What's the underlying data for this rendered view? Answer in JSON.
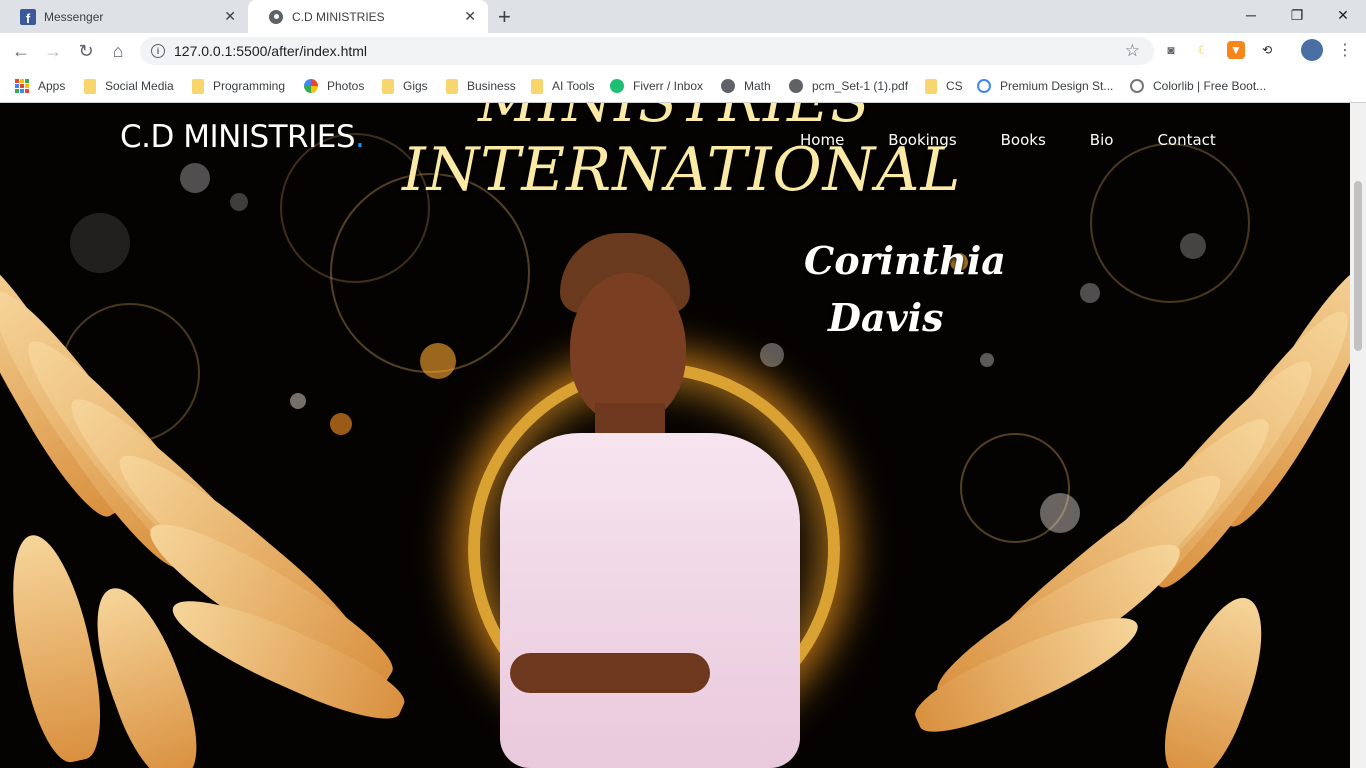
{
  "browser": {
    "tabs": [
      {
        "title": "Messenger",
        "icon": "facebook-icon",
        "active": false
      },
      {
        "title": "C.D MINISTRIES",
        "icon": "globe-icon",
        "active": true
      }
    ],
    "new_tab_symbol": "+",
    "url": "127.0.0.1:5500/after/index.html",
    "bookmarks": [
      {
        "label": "Apps",
        "icon": "apps-grid-icon"
      },
      {
        "label": "Social Media",
        "icon": "folder-icon"
      },
      {
        "label": "Programming",
        "icon": "folder-icon"
      },
      {
        "label": "Photos",
        "icon": "photos-pinwheel-icon"
      },
      {
        "label": "Gigs",
        "icon": "folder-icon"
      },
      {
        "label": "Business",
        "icon": "folder-icon"
      },
      {
        "label": "AI Tools",
        "icon": "folder-icon"
      },
      {
        "label": "Fiverr / Inbox",
        "icon": "fiverr-icon"
      },
      {
        "label": "Math",
        "icon": "globe-icon"
      },
      {
        "label": "pcm_Set-1 (1).pdf",
        "icon": "globe-icon"
      },
      {
        "label": "CS",
        "icon": "folder-icon"
      },
      {
        "label": "Premium Design St...",
        "icon": "link-icon"
      },
      {
        "label": "Colorlib | Free Boot...",
        "icon": "wordpress-icon"
      }
    ]
  },
  "site": {
    "logo": "C.D MINISTRIES",
    "logo_dot": ".",
    "banner_line1": "MINISTRIES",
    "banner_line2": "INTERNATIONAL",
    "nav": [
      "Home",
      "Bookings",
      "Books",
      "Bio",
      "Contact"
    ],
    "name_line1": "Corinthia",
    "name_line2": "Davis"
  },
  "colors": {
    "banner_gold": "#fbeaa6",
    "logo_dot_blue": "#1e90ff",
    "background": "#050302",
    "wing_gold": "#e8b36a"
  }
}
